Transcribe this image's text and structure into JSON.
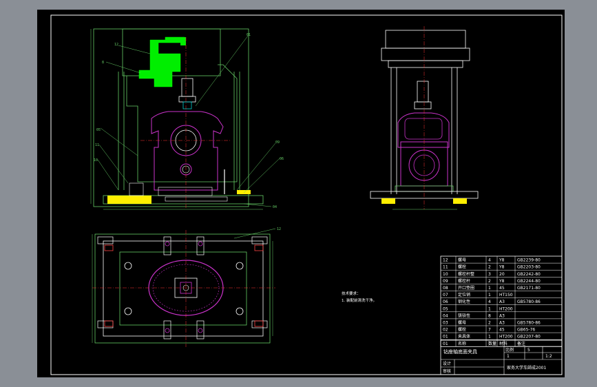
{
  "parts_list": [
    {
      "no": "12",
      "name": "螺母",
      "qty": "4",
      "material": "Y8",
      "standard": "GB2239-80"
    },
    {
      "no": "11",
      "name": "螺栓",
      "qty": "2",
      "material": "Y8",
      "standard": "GB2203-80"
    },
    {
      "no": "10",
      "name": "螺栓杆整",
      "qty": "3",
      "material": "20",
      "standard": "GB2242-80"
    },
    {
      "no": "09",
      "name": "螺栓杆",
      "qty": "2",
      "material": "Y8",
      "standard": "GB2244-80"
    },
    {
      "no": "08",
      "name": "开口垫圈",
      "qty": "1",
      "material": "45",
      "standard": "GB2171-80"
    },
    {
      "no": "07",
      "name": "定位销",
      "qty": "1",
      "material": "HT150",
      "standard": ""
    },
    {
      "no": "06",
      "name": "钢化性",
      "qty": "4",
      "material": "A3",
      "standard": "GB5780-86"
    },
    {
      "no": "05",
      "name": "",
      "qty": "1",
      "material": "HT200",
      "standard": ""
    },
    {
      "no": "04",
      "name": "铸铁性",
      "qty": "8",
      "material": "A3",
      "standard": ""
    },
    {
      "no": "03",
      "name": "螺母",
      "qty": "2",
      "material": "A3",
      "standard": "GB5780-86"
    },
    {
      "no": "02",
      "name": "螺栓",
      "qty": "7",
      "material": "45",
      "standard": "GB65-76"
    },
    {
      "no": "01",
      "name": "夹具体",
      "qty": "1",
      "material": "HT200",
      "standard": "GB2207-80"
    }
  ],
  "parts_header": {
    "no": "01",
    "name": "名称",
    "qty": "数量",
    "material": "材料",
    "standard": "备注"
  },
  "title_block": {
    "title": "钻座轴底面夹具",
    "scale_label": "比例",
    "scale": "1:2",
    "sheet_count": "5",
    "sheet_no": "1",
    "designer_label": "设计",
    "checker_label": "审核",
    "school": "家务大学车師成2001"
  },
  "tech_notes": {
    "heading": "技术要求：",
    "line1": "1. 装配前清洗干净。"
  },
  "callouts": {
    "c1": "12",
    "c2": "8",
    "c3": "01",
    "c4": "05",
    "c5": "11",
    "c6": "10",
    "c7": "09",
    "c8": "06",
    "c9": "04",
    "c10": "03",
    "c11": "02",
    "c12": "12"
  },
  "colors": {
    "sheet": "#000000",
    "frame": "#ffffff",
    "outline": "#66cc66",
    "part": "#cc33cc",
    "highlight": "#00ff00",
    "yellow": "#ffff00",
    "center": "#ff0000",
    "cyan": "#00cccc",
    "text": "#ffffff"
  }
}
